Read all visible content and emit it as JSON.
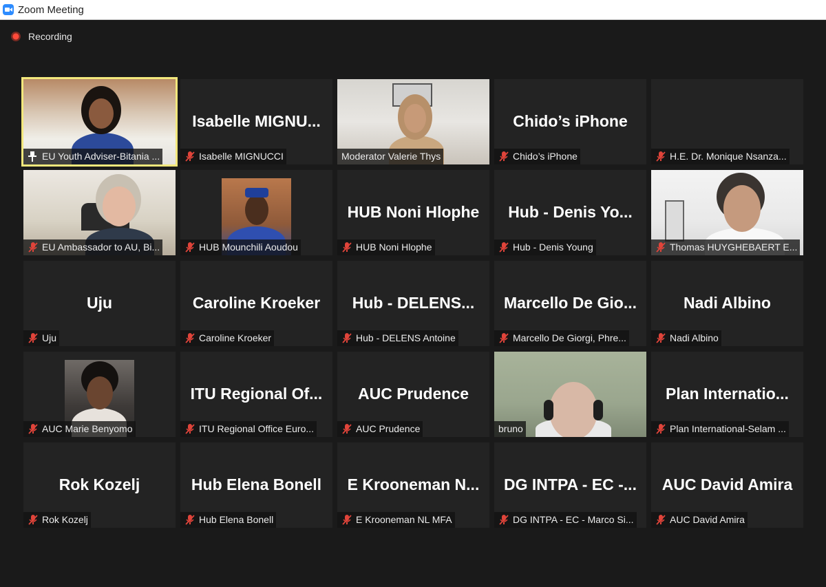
{
  "window": {
    "title": "Zoom Meeting"
  },
  "recording": {
    "label": "Recording"
  },
  "participants": [
    {
      "big": "",
      "tag": "EU Youth Adviser-Bitania ...",
      "video": true
    },
    {
      "big": "Isabelle  MIGNU...",
      "tag": "Isabelle MIGNUCCI",
      "video": false
    },
    {
      "big": "",
      "tag": "Moderator Valerie Thys",
      "video": true
    },
    {
      "big": "Chido’s iPhone",
      "tag": "Chido’s iPhone",
      "video": false
    },
    {
      "big": "",
      "tag": "H.E. Dr. Monique Nsanza...",
      "video": false
    },
    {
      "big": "",
      "tag": "EU Ambassador to AU, Bi...",
      "video": true
    },
    {
      "big": "",
      "tag": "HUB  Mounchili Aoudou",
      "video": true
    },
    {
      "big": "HUB Noni Hlophe",
      "tag": "HUB Noni Hlophe",
      "video": false
    },
    {
      "big": "Hub  -  Denis Yo...",
      "tag": "Hub - Denis Young",
      "video": false
    },
    {
      "big": "",
      "tag": "Thomas HUYGHEBAERT E...",
      "video": true
    },
    {
      "big": "Uju",
      "tag": "Uju",
      "video": false
    },
    {
      "big": "Caroline Kroeker",
      "tag": "Caroline Kroeker",
      "video": false
    },
    {
      "big": "Hub  -  DELENS...",
      "tag": "Hub - DELENS Antoine",
      "video": false
    },
    {
      "big": "Marcello  De  Gio...",
      "tag": "Marcello De Giorgi, Phre...",
      "video": false
    },
    {
      "big": "Nadi Albino",
      "tag": "Nadi Albino",
      "video": false
    },
    {
      "big": "",
      "tag": "AUC Marie  Benyomo",
      "video": true
    },
    {
      "big": "ITU  Regional  Of...",
      "tag": "ITU Regional Office Euro...",
      "video": false
    },
    {
      "big": "AUC Prudence",
      "tag": "AUC Prudence",
      "video": false
    },
    {
      "big": "",
      "tag": "bruno",
      "video": true
    },
    {
      "big": "Plan  Internatio...",
      "tag": "Plan International-Selam ...",
      "video": false
    },
    {
      "big": "Rok Kozelj",
      "tag": "Rok Kozelj",
      "video": false
    },
    {
      "big": "Hub Elena Bonell",
      "tag": "Hub Elena Bonell",
      "video": false
    },
    {
      "big": "E  Krooneman  N...",
      "tag": "E Krooneman NL MFA",
      "video": false
    },
    {
      "big": "DG  INTPA  -  EC  -...",
      "tag": "DG INTPA - EC - Marco Si...",
      "video": false
    },
    {
      "big": "AUC David Amira",
      "tag": "AUC David Amira",
      "video": false
    }
  ],
  "colors": {
    "active_speaker": "#f2e77c",
    "tile_bg": "#232323",
    "muted_icon": "#e0443a",
    "zoom_blue": "#2d8cff"
  }
}
